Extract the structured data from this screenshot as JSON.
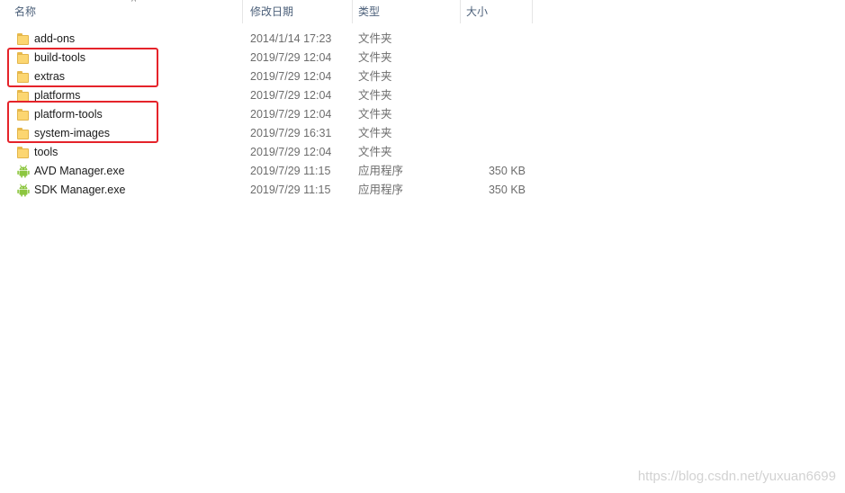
{
  "columns": {
    "name": "名称",
    "date": "修改日期",
    "type": "类型",
    "size": "大小"
  },
  "files": [
    {
      "name": "add-ons",
      "date": "2014/1/14 17:23",
      "type": "文件夹",
      "size": "",
      "icon": "folder-icon"
    },
    {
      "name": "build-tools",
      "date": "2019/7/29 12:04",
      "type": "文件夹",
      "size": "",
      "icon": "folder-icon"
    },
    {
      "name": "extras",
      "date": "2019/7/29 12:04",
      "type": "文件夹",
      "size": "",
      "icon": "folder-icon"
    },
    {
      "name": "platforms",
      "date": "2019/7/29 12:04",
      "type": "文件夹",
      "size": "",
      "icon": "folder-icon"
    },
    {
      "name": "platform-tools",
      "date": "2019/7/29 12:04",
      "type": "文件夹",
      "size": "",
      "icon": "folder-icon"
    },
    {
      "name": "system-images",
      "date": "2019/7/29 16:31",
      "type": "文件夹",
      "size": "",
      "icon": "folder-icon"
    },
    {
      "name": "tools",
      "date": "2019/7/29 12:04",
      "type": "文件夹",
      "size": "",
      "icon": "folder-icon"
    },
    {
      "name": "AVD Manager.exe",
      "date": "2019/7/29 11:15",
      "type": "应用程序",
      "size": "350 KB",
      "icon": "android-app-icon"
    },
    {
      "name": "SDK Manager.exe",
      "date": "2019/7/29 11:15",
      "type": "应用程序",
      "size": "350 KB",
      "icon": "android-app-icon"
    }
  ],
  "watermark": "https://blog.csdn.net/yuxuan6699",
  "colors": {
    "highlight": "#e5232a",
    "folder": "#fcd671",
    "android": "#8cc63f"
  }
}
